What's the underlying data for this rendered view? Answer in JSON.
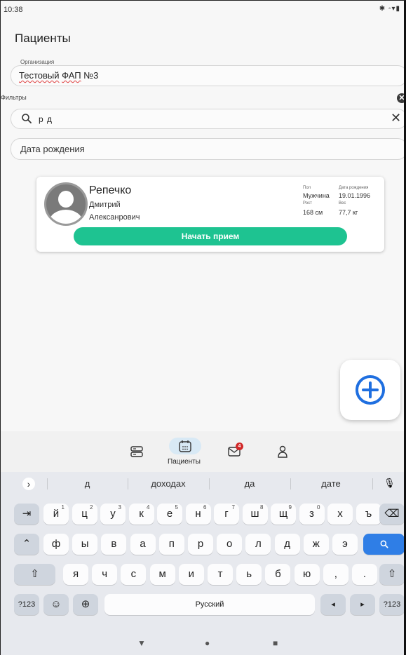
{
  "status_bar": {
    "time": "10:38",
    "icons": "✱ ◦▾▮"
  },
  "page": {
    "title": "Пациенты"
  },
  "organization": {
    "label": "Организация",
    "value_part1": "Тестовый",
    "value_part2": " ",
    "value_part3": "ФАП",
    "value_part4": " №3"
  },
  "filters": {
    "label": "Фильтры",
    "clear_icon": "✕"
  },
  "search": {
    "value": "р д",
    "clear_icon": "✕"
  },
  "birthdate": {
    "placeholder": "Дата рождения"
  },
  "patient": {
    "last_name": "Репечко",
    "first_name": "Дмитрий",
    "middle_name": "Алексанрович",
    "sex_label": "Пол",
    "sex_value": "Мужчина",
    "dob_label": "Дата рождения",
    "dob_value": "19.01.1996",
    "height_label": "Рост",
    "height_value": "168 см",
    "weight_label": "Вес",
    "weight_value": "77,7 кг",
    "start_button": "Начать прием"
  },
  "bottom_nav": {
    "active_label": "Пациенты",
    "badge_count": "4"
  },
  "keyboard": {
    "suggestions": [
      "д",
      "доходах",
      "да",
      "дате"
    ],
    "row1": [
      {
        "k": "й",
        "s": "1"
      },
      {
        "k": "ц",
        "s": "2"
      },
      {
        "k": "у",
        "s": "3"
      },
      {
        "k": "к",
        "s": "4"
      },
      {
        "k": "е",
        "s": "5"
      },
      {
        "k": "н",
        "s": "6"
      },
      {
        "k": "г",
        "s": "7"
      },
      {
        "k": "ш",
        "s": "8"
      },
      {
        "k": "щ",
        "s": "9"
      },
      {
        "k": "з",
        "s": "0"
      },
      {
        "k": "х",
        "s": ""
      },
      {
        "k": "ъ",
        "s": ""
      }
    ],
    "row2": [
      "ф",
      "ы",
      "в",
      "а",
      "п",
      "р",
      "о",
      "л",
      "д",
      "ж",
      "э"
    ],
    "row3": [
      "я",
      "ч",
      "с",
      "м",
      "и",
      "т",
      "ь",
      "б",
      "ю",
      ",",
      "."
    ],
    "tab_key": "⇥",
    "caps_key": "⌃",
    "shift_key": "⇧",
    "backspace_key": "⌫",
    "symbols_key": "?123",
    "emoji_key": "☺",
    "globe_key": "⊕",
    "space_label": "Русский",
    "left_key": "◂",
    "right_key": "▸",
    "expand_key": "›",
    "mic_key": "🎙"
  },
  "android_nav": {
    "back": "▼",
    "home": "●",
    "recents": "■"
  },
  "colors": {
    "accent_green": "#1ec391",
    "fab_blue": "#1f6fe0",
    "key_blue": "#2f7ee6"
  }
}
